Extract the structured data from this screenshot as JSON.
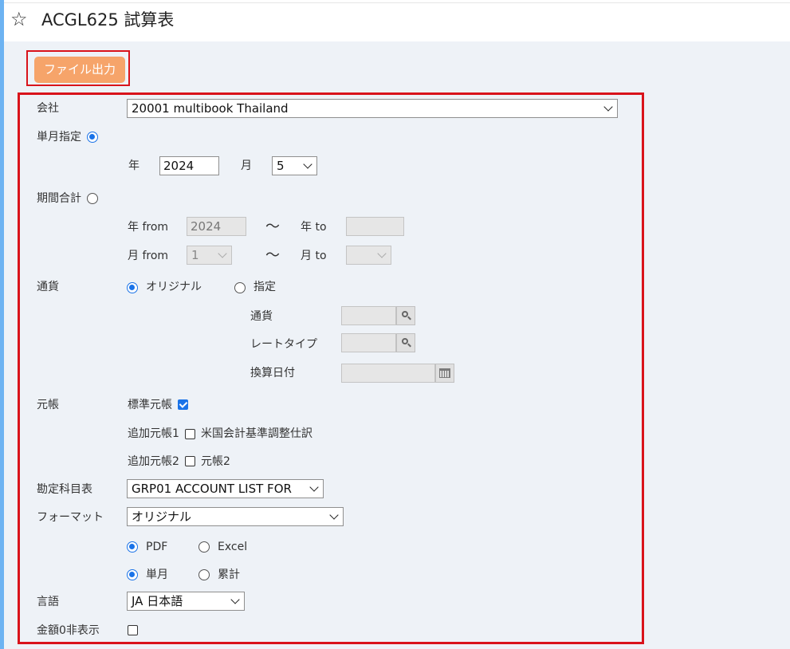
{
  "header": {
    "title": "ACGL625 試算表",
    "star_icon": "star-outline-icon"
  },
  "toolbar": {
    "file_output_label": "ファイル出力"
  },
  "form": {
    "company": {
      "label": "会社",
      "value": "20001 multibook Thailand"
    },
    "single_month": {
      "label": "単月指定",
      "selected": true,
      "year_label": "年",
      "year_value": "2024",
      "month_label": "月",
      "month_value": "5"
    },
    "period_total": {
      "label": "期間合計",
      "selected": false,
      "year_from_label": "年 from",
      "year_from_value": "2024",
      "year_to_label": "年 to",
      "year_to_value": "",
      "month_from_label": "月 from",
      "month_from_value": "1",
      "month_to_label": "月 to",
      "month_to_value": "",
      "tilde": "〜"
    },
    "currency": {
      "label": "通貨",
      "original_label": "オリジナル",
      "specified_label": "指定",
      "selected": "original",
      "currency_field_label": "通貨",
      "currency_field_value": "",
      "rate_type_label": "レートタイプ",
      "rate_type_value": "",
      "conversion_date_label": "換算日付",
      "conversion_date_value": ""
    },
    "ledger": {
      "label": "元帳",
      "standard_label": "標準元帳",
      "standard_checked": true,
      "additional1_label": "追加元帳1",
      "additional1_option": "米国会計基準調整仕訳",
      "additional1_checked": false,
      "additional2_label": "追加元帳2",
      "additional2_option": "元帳2",
      "additional2_checked": false
    },
    "chart_of_accounts": {
      "label": "勘定科目表",
      "value": "GRP01 ACCOUNT LIST FOR"
    },
    "format": {
      "label": "フォーマット",
      "value": "オリジナル",
      "pdf_label": "PDF",
      "excel_label": "Excel",
      "output_type": "pdf",
      "single_month_label": "単月",
      "cumulative_label": "累計",
      "aggregation": "single_month"
    },
    "language": {
      "label": "言語",
      "value": "JA 日本語"
    },
    "hide_zero": {
      "label": "金額0非表示",
      "checked": false
    }
  },
  "colors": {
    "accent": "#1a73e8",
    "button_orange": "#f6a46a",
    "highlight_red": "#d9131b",
    "left_bar": "#6db3f2"
  }
}
